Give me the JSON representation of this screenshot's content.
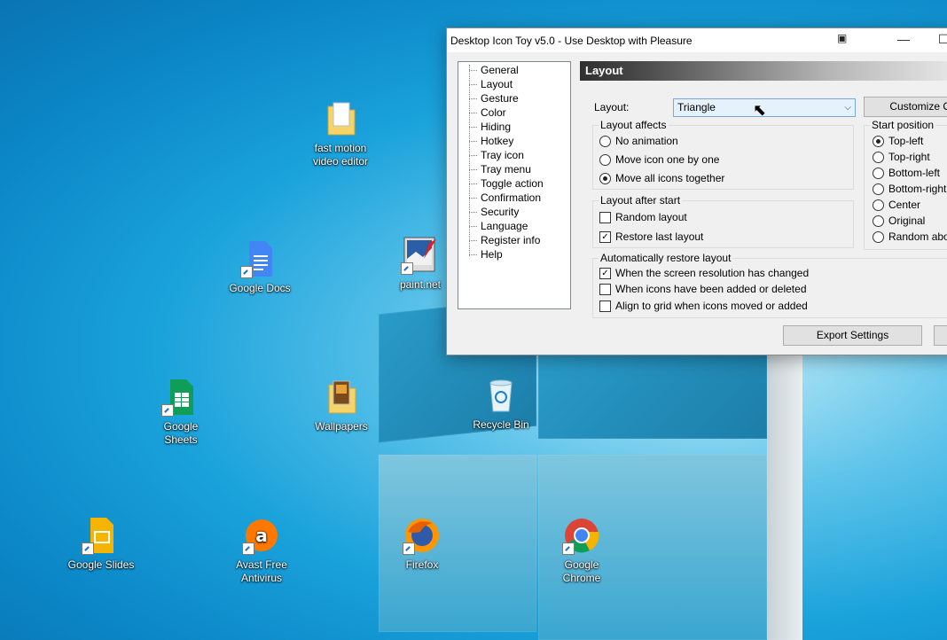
{
  "desktop": {
    "icons": [
      {
        "label": "fast motion\nvideo editor"
      },
      {
        "label": "Google Docs"
      },
      {
        "label": "paint.net"
      },
      {
        "label": "Google\nSheets"
      },
      {
        "label": "Wallpapers"
      },
      {
        "label": "Recycle Bin"
      },
      {
        "label": "Google Slides"
      },
      {
        "label": "Avast Free\nAntivirus"
      },
      {
        "label": "Firefox"
      },
      {
        "label": "Google\nChrome"
      }
    ]
  },
  "window": {
    "title": "Desktop Icon Toy v5.0 - Use Desktop with Pleasure",
    "tree": [
      "General",
      "Layout",
      "Gesture",
      "Color",
      "Hiding",
      "Hotkey",
      "Tray icon",
      "Tray menu",
      "Toggle action",
      "Confirmation",
      "Security",
      "Language",
      "Register info",
      "Help"
    ],
    "header": "Layout",
    "layout_label": "Layout:",
    "layout_value": "Triangle",
    "customize_btn": "Customize Or",
    "layout_affects": {
      "title": "Layout affects",
      "options": [
        "No animation",
        "Move icon one by one",
        "Move all icons together"
      ],
      "selected": 2
    },
    "layout_after_start": {
      "title": "Layout after start",
      "options": [
        {
          "label": "Random layout",
          "checked": false
        },
        {
          "label": "Restore last layout",
          "checked": true
        }
      ]
    },
    "auto_restore": {
      "title": "Automatically restore layout",
      "options": [
        {
          "label": "When the screen resolution has changed",
          "checked": true
        },
        {
          "label": "When icons have been added or deleted",
          "checked": false
        },
        {
          "label": "Align to grid when icons moved or added",
          "checked": false
        }
      ]
    },
    "start_position": {
      "title": "Start position",
      "options": [
        "Top-left",
        "Top-right",
        "Bottom-left",
        "Bottom-right",
        "Center",
        "Original",
        "Random above"
      ],
      "selected": 0
    },
    "export_btn": "Export Settings"
  }
}
